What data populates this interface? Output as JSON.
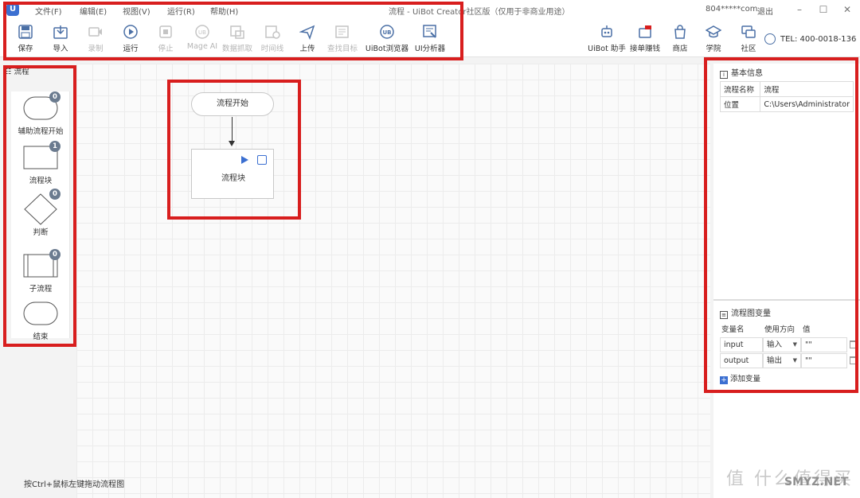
{
  "window": {
    "menu": [
      "文件(F)",
      "编辑(E)",
      "视图(V)",
      "运行(R)",
      "帮助(H)"
    ],
    "title": "流程 - UiBot Creator社区版（仅用于非商业用途）",
    "account": "804*****com",
    "logout": "退出"
  },
  "toolbar": {
    "left": [
      {
        "label": "保存",
        "icon": "save-icon",
        "enabled": true
      },
      {
        "label": "导入",
        "icon": "import-icon",
        "enabled": true
      },
      {
        "label": "录制",
        "icon": "record-icon",
        "enabled": false
      },
      {
        "label": "运行",
        "icon": "run-icon",
        "enabled": true
      },
      {
        "label": "停止",
        "icon": "stop-icon",
        "enabled": false
      },
      {
        "label": "Mage AI",
        "icon": "mage-ai-icon",
        "enabled": false
      },
      {
        "label": "数据抓取",
        "icon": "data-scrape-icon",
        "enabled": false
      },
      {
        "label": "时间线",
        "icon": "timeline-icon",
        "enabled": false
      },
      {
        "label": "上传",
        "icon": "upload-icon",
        "enabled": true
      },
      {
        "label": "查找目标",
        "icon": "find-target-icon",
        "enabled": false
      },
      {
        "label": "UiBot浏览器",
        "icon": "uibot-browser-icon",
        "enabled": true
      },
      {
        "label": "UI分析器",
        "icon": "ui-analyzer-icon",
        "enabled": true
      }
    ],
    "right": [
      {
        "label": "UiBot 助手",
        "icon": "robot-icon"
      },
      {
        "label": "接单赚钱",
        "icon": "earn-icon"
      },
      {
        "label": "商店",
        "icon": "store-icon"
      },
      {
        "label": "学院",
        "icon": "academy-icon"
      },
      {
        "label": "社区",
        "icon": "community-icon"
      }
    ],
    "tel": "TEL: 400-0018-136"
  },
  "palette": {
    "title": "流程",
    "items": [
      {
        "label": "辅助流程开始",
        "count": "0"
      },
      {
        "label": "流程块",
        "count": "1"
      },
      {
        "label": "判断",
        "count": "0"
      },
      {
        "label": "子流程",
        "count": "0"
      },
      {
        "label": "结束",
        "count": ""
      }
    ]
  },
  "canvas": {
    "start_label": "流程开始",
    "block_label": "流程块",
    "hint": "按Ctrl+鼠标左键拖动流程图"
  },
  "basic_info": {
    "title": "基本信息",
    "rows": [
      {
        "key": "流程名称",
        "value": "流程"
      },
      {
        "key": "位置",
        "value": "C:\\Users\\Administrator"
      }
    ]
  },
  "variables": {
    "title": "流程图变量",
    "headers": [
      "变量名",
      "使用方向",
      "值"
    ],
    "rows": [
      {
        "name": "input",
        "direction": "输入",
        "value": "\"\""
      },
      {
        "name": "output",
        "direction": "输出",
        "value": "\"\""
      }
    ],
    "add_label": "添加变量"
  },
  "watermark": {
    "text": "值 什么值得买",
    "site": "SMYZ.NET"
  },
  "colors": {
    "highlight": "#d81e1e",
    "accent": "#3b6fd1"
  }
}
